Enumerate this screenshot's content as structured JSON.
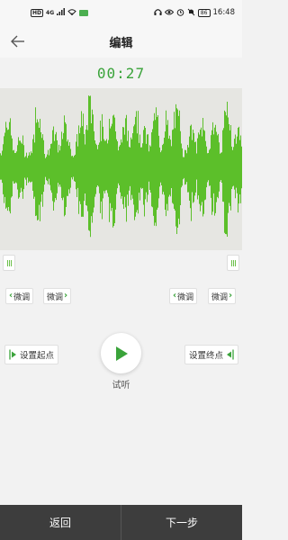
{
  "status_bar": {
    "hd_label": "HD",
    "signal_label": "4G",
    "battery": "86",
    "time": "16:48"
  },
  "header": {
    "title": "编辑"
  },
  "timer": "00:27",
  "colors": {
    "accent": "#3aa33a",
    "wave": "#5cbf2a",
    "wave_bg": "#e6e6e2",
    "bottom_bar": "#3d3d3d"
  },
  "fine_tune": {
    "start_minus": "微调",
    "start_plus": "微调",
    "end_minus": "微调",
    "end_plus": "微调"
  },
  "set_start": "设置起点",
  "set_end": "设置终点",
  "preview_label": "试听",
  "bottom": {
    "back": "返回",
    "next": "下一步"
  }
}
